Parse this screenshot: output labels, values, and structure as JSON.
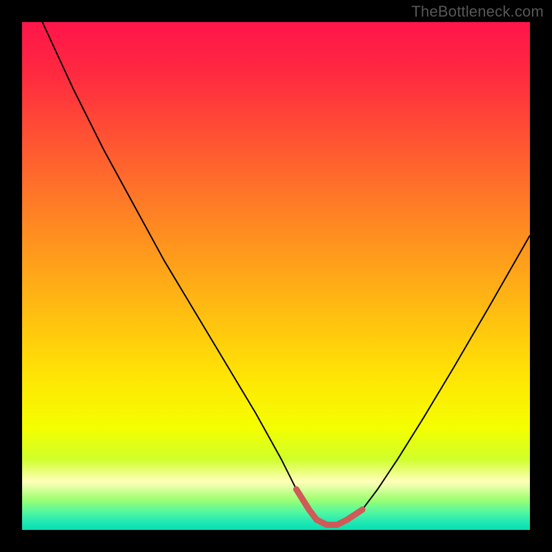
{
  "watermark": "TheBottleneck.com",
  "colors": {
    "frame": "#000000",
    "watermark_text": "#575757",
    "curve_stroke": "#000000",
    "valley_stroke": "#cf5a57",
    "gradient_stops": [
      {
        "offset": 0.0,
        "color": "#ff154a"
      },
      {
        "offset": 0.1,
        "color": "#ff2940"
      },
      {
        "offset": 0.22,
        "color": "#ff5034"
      },
      {
        "offset": 0.34,
        "color": "#ff7628"
      },
      {
        "offset": 0.46,
        "color": "#ff9b1c"
      },
      {
        "offset": 0.58,
        "color": "#ffc010"
      },
      {
        "offset": 0.7,
        "color": "#ffe504"
      },
      {
        "offset": 0.8,
        "color": "#f4ff00"
      },
      {
        "offset": 0.86,
        "color": "#d0ff2a"
      },
      {
        "offset": 0.905,
        "color": "#ffffbb"
      },
      {
        "offset": 0.94,
        "color": "#9eff71"
      },
      {
        "offset": 0.965,
        "color": "#52f7a0"
      },
      {
        "offset": 0.985,
        "color": "#1fe8b4"
      },
      {
        "offset": 1.0,
        "color": "#06dfb1"
      }
    ]
  },
  "chart_data": {
    "type": "line",
    "title": "",
    "xlabel": "",
    "ylabel": "",
    "xlim": [
      0,
      100
    ],
    "ylim": [
      0,
      100
    ],
    "series": [
      {
        "name": "bottleneck-curve",
        "x": [
          4,
          10,
          16,
          22,
          28,
          34,
          40,
          46,
          51,
          54,
          56.5,
          58,
          60,
          62,
          64,
          67,
          70,
          74,
          79,
          85,
          92,
          100
        ],
        "values": [
          100,
          87,
          75,
          64,
          53,
          43,
          33,
          23,
          14,
          8,
          4,
          2,
          1,
          1,
          2,
          4,
          8,
          14,
          22,
          32,
          44,
          58
        ]
      }
    ],
    "annotations": [
      {
        "name": "valley-floor-highlight",
        "x": [
          54,
          56.5,
          58,
          60,
          62,
          64,
          67
        ],
        "values": [
          8,
          4,
          2,
          1,
          1,
          2,
          4
        ]
      }
    ]
  }
}
